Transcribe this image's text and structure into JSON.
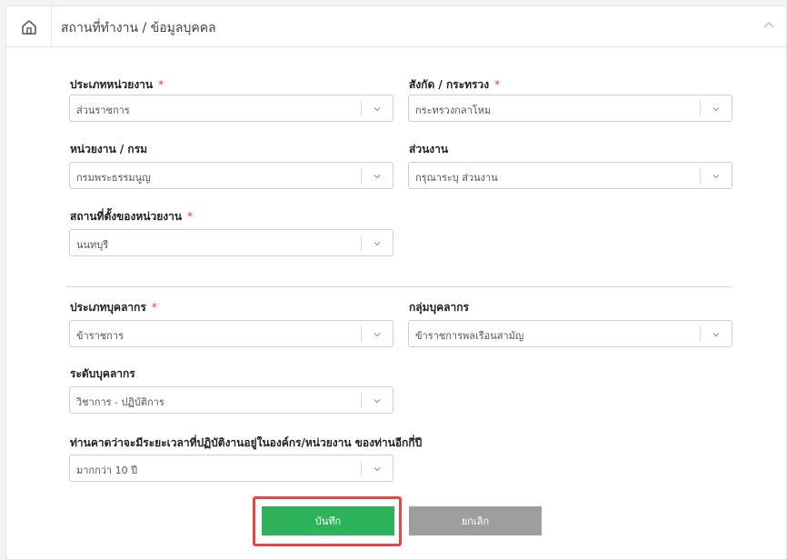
{
  "header": {
    "breadcrumb": "สถานที่ทำงาน / ข้อมูลบุคคล",
    "home_icon": "home-icon",
    "collapse_icon": "chevron-up-icon"
  },
  "required_mark": "*",
  "fields": {
    "org_type": {
      "label": "ประเภทหน่วยงาน",
      "value": "ส่วนราชการ",
      "required": true
    },
    "ministry": {
      "label": "สังกัด / กระทรวง",
      "value": "กระทรวงกลาโหม",
      "required": true
    },
    "department": {
      "label": "หน่วยงาน / กรม",
      "value": "กรมพระธรรมนูญ",
      "required": false
    },
    "division": {
      "label": "ส่วนงาน",
      "value": "กรุณาระบุ ส่วนงาน",
      "required": false
    },
    "location": {
      "label": "สถานที่ตั้งของหน่วยงาน",
      "value": "นนทบุรี",
      "required": true
    },
    "personnel_type": {
      "label": "ประเภทบุคลากร",
      "value": "ข้าราชการ",
      "required": true
    },
    "personnel_group": {
      "label": "กลุ่มบุคลากร",
      "value": "ข้าราชการพลเรือนสามัญ",
      "required": false
    },
    "personnel_level": {
      "label": "ระดับบุคลากร",
      "value": "วิชาการ - ปฏิบัติการ",
      "required": false
    },
    "expected_years": {
      "label": "ท่านคาดว่าจะมีระยะเวลาที่ปฏิบัติงานอยู่ในองค์กร/หน่วยงาน ของท่านอีกกี่ปี",
      "value": "มากกว่า 10 ปี",
      "required": false
    }
  },
  "buttons": {
    "save": "บันทึก",
    "cancel": "ยกเลิก"
  },
  "colors": {
    "save": "#2fb35a",
    "cancel": "#9e9e9e",
    "highlight": "#e24848",
    "required": "#e5383b"
  }
}
